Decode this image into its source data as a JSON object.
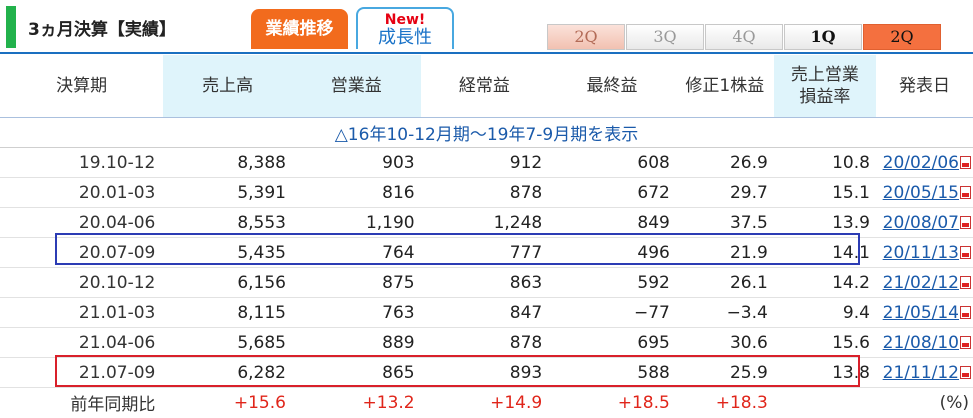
{
  "header": {
    "title": "3ヵ月決算【実績】",
    "tab_performance": "業績推移",
    "tab_growth_new": "New!",
    "tab_growth": "成長性",
    "quarters": [
      "2Q",
      "3Q",
      "4Q",
      "1Q",
      "2Q"
    ]
  },
  "table": {
    "columns": [
      "決算期",
      "売上高",
      "営業益",
      "経常益",
      "最終益",
      "修正1株益",
      "売上営業",
      "損益率",
      "発表日"
    ],
    "banner": "△16年10-12月期～19年7-9月期を表示",
    "rows": [
      {
        "period": "19.10-12",
        "sales": "8,388",
        "op": "903",
        "ord": "912",
        "net": "608",
        "eps": "26.9",
        "margin": "10.8",
        "date": "20/02/06"
      },
      {
        "period": "20.01-03",
        "sales": "5,391",
        "op": "816",
        "ord": "878",
        "net": "672",
        "eps": "29.7",
        "margin": "15.1",
        "date": "20/05/15"
      },
      {
        "period": "20.04-06",
        "sales": "8,553",
        "op": "1,190",
        "ord": "1,248",
        "net": "849",
        "eps": "37.5",
        "margin": "13.9",
        "date": "20/08/07"
      },
      {
        "period": "20.07-09",
        "sales": "5,435",
        "op": "764",
        "ord": "777",
        "net": "496",
        "eps": "21.9",
        "margin": "14.1",
        "date": "20/11/13"
      },
      {
        "period": "20.10-12",
        "sales": "6,156",
        "op": "875",
        "ord": "863",
        "net": "592",
        "eps": "26.1",
        "margin": "14.2",
        "date": "21/02/12"
      },
      {
        "period": "21.01-03",
        "sales": "8,115",
        "op": "763",
        "ord": "847",
        "net": "−77",
        "eps": "−3.4",
        "margin": "9.4",
        "date": "21/05/14"
      },
      {
        "period": "21.04-06",
        "sales": "5,685",
        "op": "889",
        "ord": "878",
        "net": "695",
        "eps": "30.6",
        "margin": "15.6",
        "date": "21/08/10"
      },
      {
        "period": "21.07-09",
        "sales": "6,282",
        "op": "865",
        "ord": "893",
        "net": "588",
        "eps": "25.9",
        "margin": "13.8",
        "date": "21/11/12"
      }
    ],
    "yoy": {
      "label": "前年同期比",
      "sales": "+15.6",
      "op": "+13.2",
      "ord": "+14.9",
      "net": "+18.5",
      "eps": "+18.3",
      "unit": "(%)"
    }
  },
  "colors": {
    "accent_orange": "#f26b1d",
    "brand_green": "#22b24c",
    "link_blue": "#1a5aaa",
    "positive_red": "#e0251a"
  }
}
